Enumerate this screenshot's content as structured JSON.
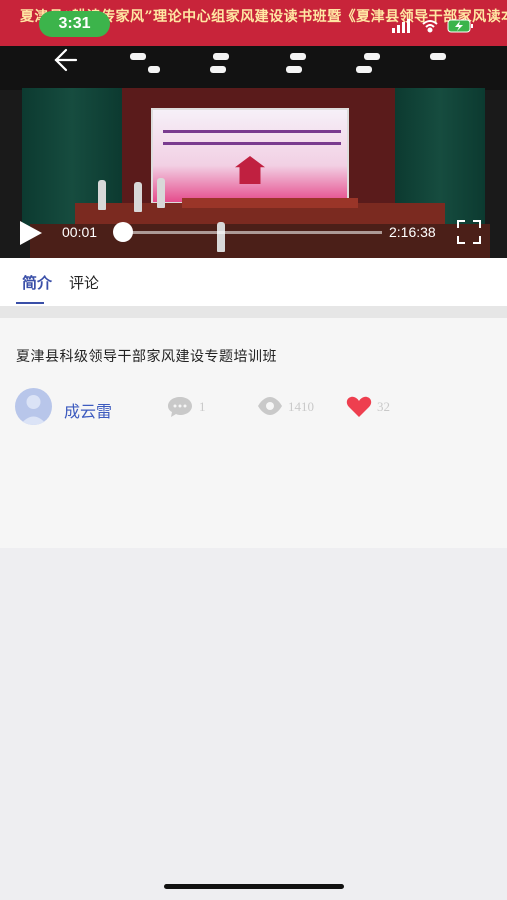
{
  "status_bar": {
    "time": "3:31",
    "icons": [
      "signal-icon",
      "wifi-icon",
      "battery-charging-icon"
    ]
  },
  "video": {
    "banner_text": "夏津县“耕读传家风”理论中心组家风建设读书班暨《夏津县领导干部家风读本》首发仪式",
    "current_time": "00:01",
    "total_time": "2:16:38",
    "progress": 0.0001
  },
  "tabs": [
    {
      "label": "简介",
      "active": true
    },
    {
      "label": "评论",
      "active": false
    }
  ],
  "detail": {
    "title": "夏津县科级领导干部家风建设专题培训班",
    "author": "成云雷",
    "comments": "1",
    "views": "1410",
    "likes": "32"
  },
  "colors": {
    "accent": "#3a4fa8",
    "like": "#ee3f4f",
    "status_pill": "#3cb44b"
  }
}
